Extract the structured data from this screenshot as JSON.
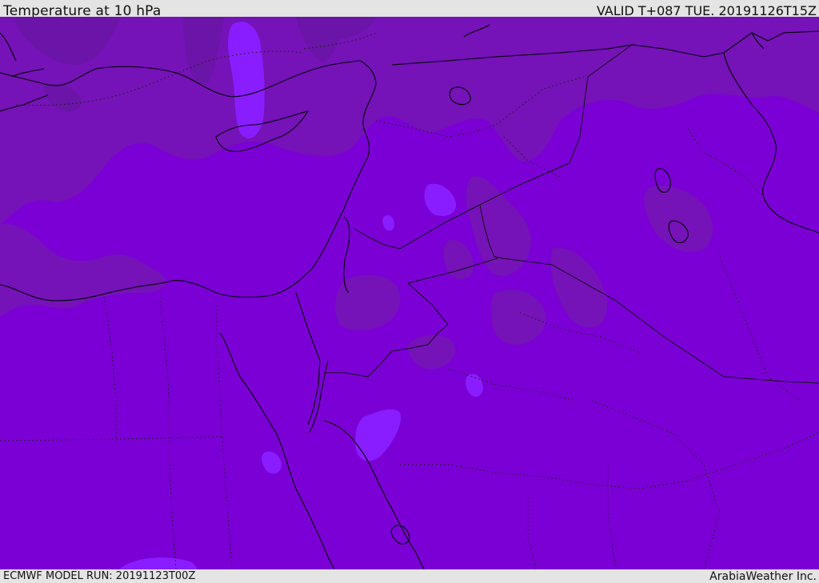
{
  "header": {
    "title": "Temperature at 10 hPa",
    "valid": "VALID T+087 TUE. 20191126T15Z"
  },
  "footer": {
    "model_run": "ECMWF MODEL RUN: 20191123T00Z",
    "credit": "ArabiaWeather Inc."
  },
  "colors": {
    "base": "#7b00d6",
    "darker_band": "#7512b8",
    "darkest_band": "#6a14a8",
    "lighter_band": "#8a1dff",
    "lightest_band": "#9930ff",
    "coastline": "#000000",
    "border": "#111111"
  }
}
